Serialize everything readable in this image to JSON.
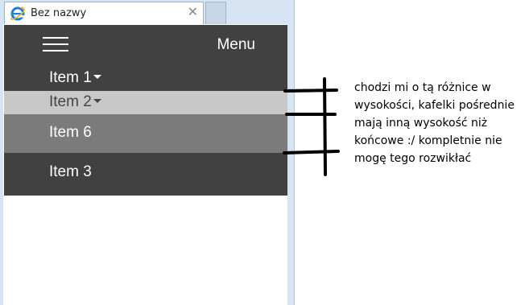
{
  "browser": {
    "tab_title": "Bez nazwy",
    "tab_close": "✕",
    "tab_icon": "internet-explorer-icon"
  },
  "navbar": {
    "menu_label": "Menu",
    "items": [
      {
        "label": "Item 1",
        "has_dropdown": true
      },
      {
        "label": "Item 2",
        "has_dropdown": true,
        "state": "hover"
      },
      {
        "label": "Item 6",
        "has_dropdown": false,
        "state": "active"
      },
      {
        "label": "Item 3",
        "has_dropdown": false
      }
    ]
  },
  "annotation": {
    "note": "chodzi mi o tą różnice w wysokości, kafelki pośrednie mają inną wysokość niż końcowe :/ kompletnie nie mogę tego rozwikłać"
  },
  "colors": {
    "navbar_bg": "#414141",
    "hover_bg": "#c8c8c8",
    "active_bg": "#7b7b7b",
    "chrome": "#d6e4f4"
  }
}
